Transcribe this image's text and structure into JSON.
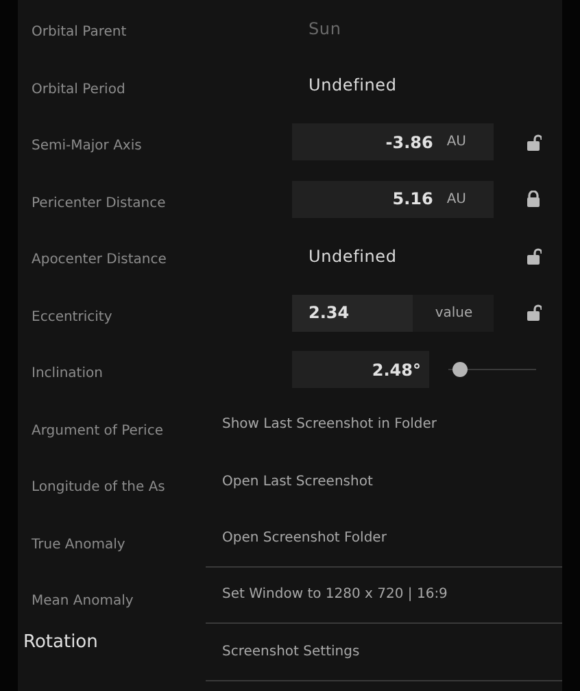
{
  "properties": [
    {
      "kind": "text",
      "label": "Orbital Parent",
      "value": "Sun",
      "disabled": true
    },
    {
      "kind": "text",
      "label": "Orbital Period",
      "value": "Undefined",
      "disabled": false
    },
    {
      "kind": "field",
      "label": "Semi-Major Axis",
      "value": "-3.86",
      "unit": "AU",
      "locked": false
    },
    {
      "kind": "field",
      "label": "Pericenter Distance",
      "value": "5.16",
      "unit": "AU",
      "locked": true
    },
    {
      "kind": "lockable",
      "label": "Apocenter Distance",
      "value": "Undefined",
      "locked": false
    },
    {
      "kind": "split",
      "label": "Eccentricity",
      "value": "2.34",
      "unit": "value",
      "locked": false
    },
    {
      "kind": "slider",
      "label": "Inclination",
      "value": "2.48°",
      "level": 0.04
    },
    {
      "kind": "label",
      "label": "Argument of Perice"
    },
    {
      "kind": "label",
      "label": "Longitude of the As"
    },
    {
      "kind": "label",
      "label": "True Anomaly"
    },
    {
      "kind": "label",
      "label": "Mean Anomaly"
    }
  ],
  "section": "Rotation",
  "menu": [
    {
      "label": "Show Last Screenshot in Folder",
      "separator": false
    },
    {
      "label": "Open Last Screenshot",
      "separator": false
    },
    {
      "label": "Open Screenshot Folder",
      "separator": true
    },
    {
      "label": "Set Window to 1280 x 720 | 16:9",
      "separator": true
    },
    {
      "label": "Screenshot Settings",
      "separator": true
    }
  ]
}
